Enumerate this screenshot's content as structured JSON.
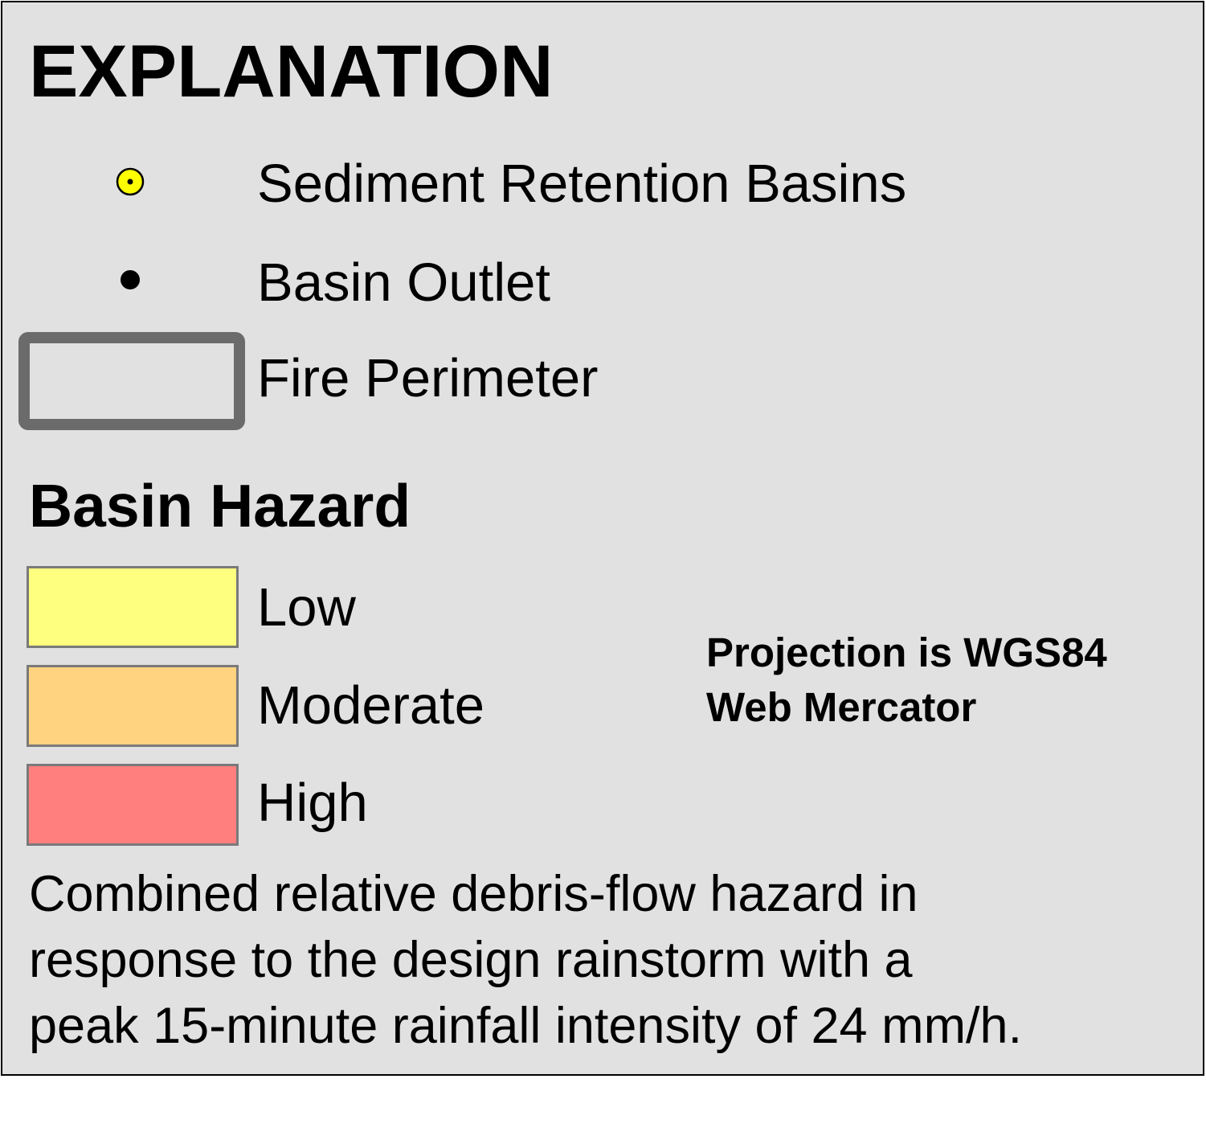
{
  "legend": {
    "title": "EXPLANATION",
    "symbols": [
      {
        "label": "Sediment Retention Basins",
        "icon": "yellow-circle-dot-icon"
      },
      {
        "label": "Basin Outlet",
        "icon": "black-dot-icon"
      },
      {
        "label": "Fire Perimeter",
        "icon": "gray-outline-rectangle-icon"
      }
    ],
    "hazard": {
      "title": "Basin Hazard",
      "classes": [
        {
          "label": "Low",
          "color": "#ffff7f"
        },
        {
          "label": "Moderate",
          "color": "#ffd37f"
        },
        {
          "label": "High",
          "color": "#ff7f7f"
        }
      ]
    },
    "projection": {
      "line1": "Projection is WGS84",
      "line2": "Web Mercator"
    },
    "description": {
      "line1": "Combined relative debris-flow hazard in",
      "line2": "response to the design rainstorm with a",
      "line3": "peak 15-minute rainfall intensity of 24 mm/h."
    },
    "colors": {
      "panel_background": "#e1e1e1",
      "retention_basin_fill": "#ffff00",
      "fire_perimeter_stroke": "#6b6b6b"
    }
  }
}
